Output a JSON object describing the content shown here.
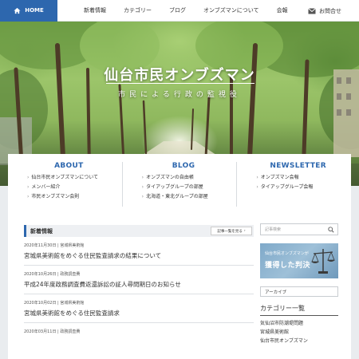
{
  "nav": {
    "home_label": "HOME",
    "items": [
      "新着情報",
      "カテゴリー",
      "ブログ",
      "オンブズマンについて",
      "会報"
    ],
    "contact_label": "お問合せ"
  },
  "hero": {
    "title": "仙台市民オンブズマン",
    "subtitle": "市民による行政の監視役"
  },
  "columns": [
    {
      "title": "ABOUT",
      "items": [
        "仙台市民オンブズマンについて",
        "メンバー紹介",
        "市民オンブズマン会則"
      ]
    },
    {
      "title": "BLOG",
      "items": [
        "オンブズマンの自由帳",
        "タイアップグループの部屋",
        "北海道・東北グループの部屋"
      ]
    },
    {
      "title": "NEWSLETTER",
      "items": [
        "オンブズマン会報",
        "タイアップグループ会報"
      ]
    }
  ],
  "news": {
    "heading": "新着情報",
    "more_label": "記事一覧を見る",
    "articles": [
      {
        "meta": "2020年11月30日 | 宮城県美術館",
        "title": "宮城県美術館をめぐる住民監査請求の結果について"
      },
      {
        "meta": "2020年10月26日 | 政務調査費",
        "title": "平成24年度政務調査費返還訴訟の証人尋問期日のお知らせ"
      },
      {
        "meta": "2020年10月02日 | 宮城県美術館",
        "title": "宮城県美術館をめぐる住民監査請求"
      },
      {
        "meta": "2020年03月11日 | 政務調査費",
        "title": ""
      }
    ]
  },
  "sidebar": {
    "search_placeholder": "記事検索",
    "banner_line1": "仙台市民オンブズマンが",
    "banner_line2": "獲得した判決",
    "archive_label": "アーカイブ",
    "category_heading": "カテゴリー一覧",
    "categories": [
      "気仙沼市防潮堤問題",
      "宮城県美術館",
      "仙台市民オンブズマン"
    ]
  },
  "colors": {
    "accent": "#2d67ae",
    "background": "#e9ecef"
  }
}
